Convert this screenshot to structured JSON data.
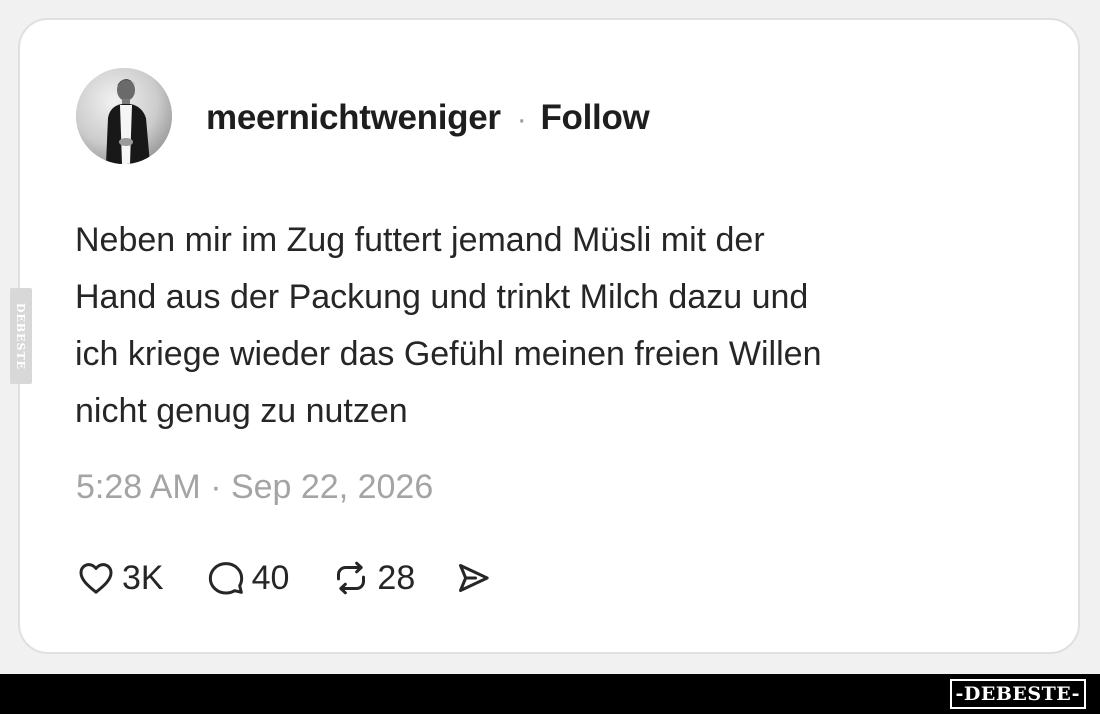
{
  "post": {
    "username": "meernichtweniger",
    "separator": "·",
    "follow_label": "Follow",
    "text": "Neben mir im Zug futtert jemand Müsli mit der\nHand aus der Packung und trinkt Milch dazu und\nich kriege wieder das Gefühl meinen freien Willen\nnicht genug zu nutzen",
    "timestamp": "5:28 AM · Sep 22, 2026"
  },
  "actions": {
    "likes": {
      "icon": "heart-icon",
      "count": "3K"
    },
    "replies": {
      "icon": "comment-icon",
      "count": "40"
    },
    "reposts": {
      "icon": "repost-icon",
      "count": "28"
    },
    "share": {
      "icon": "send-icon"
    }
  },
  "watermark": {
    "side_text": "DEBESTE",
    "logo_text": "-DEBESTE-"
  },
  "colors": {
    "background": "#f1f1f1",
    "card": "#ffffff",
    "text": "#262626",
    "muted": "#a4a4a4",
    "footer_bar": "#000000"
  }
}
